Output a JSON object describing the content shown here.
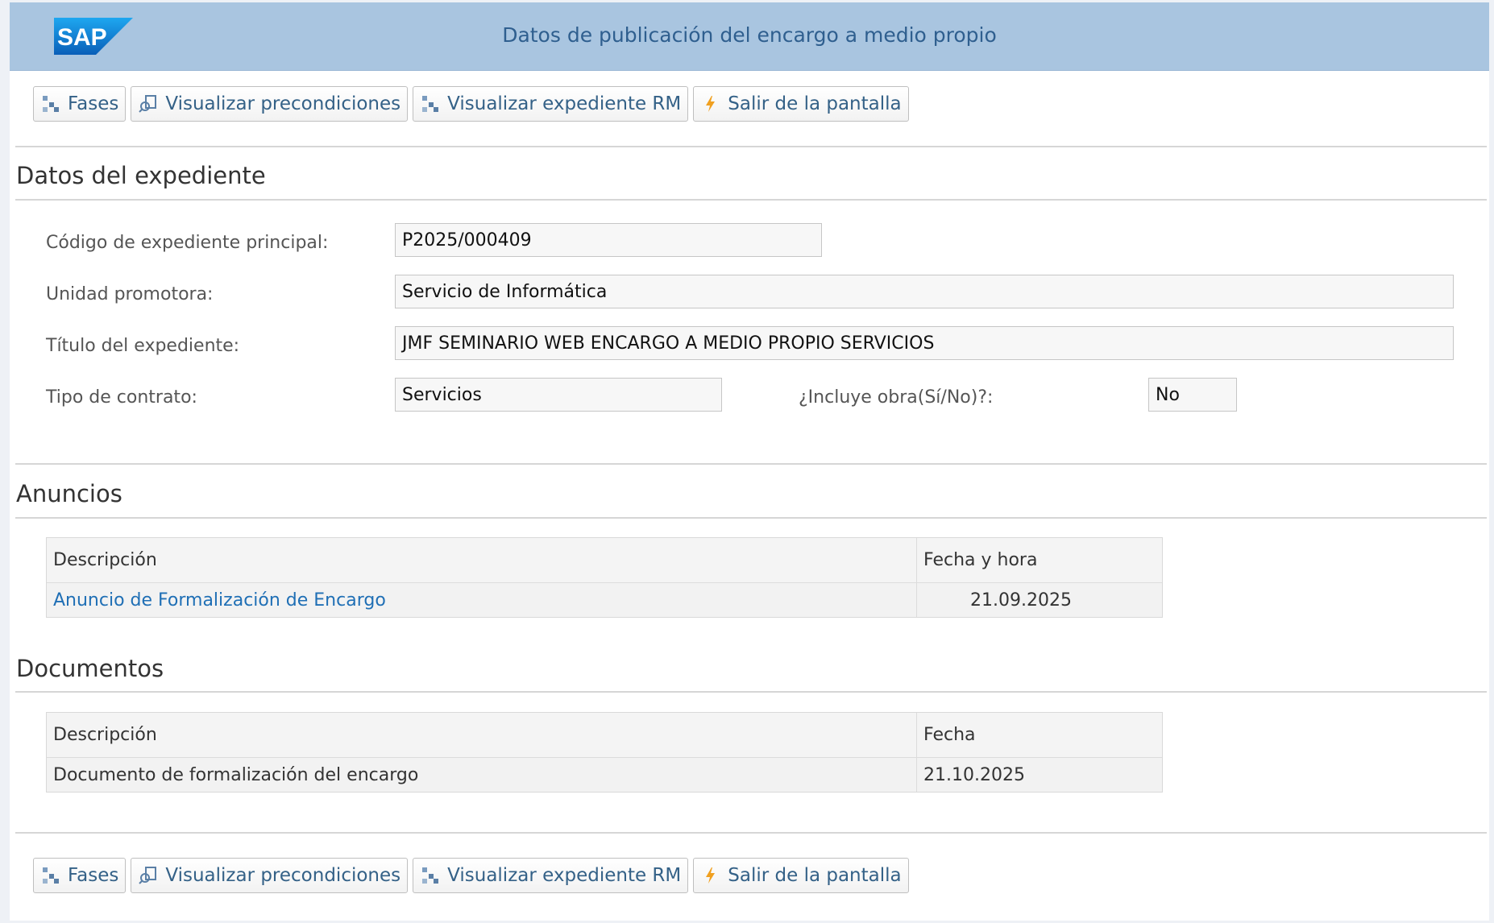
{
  "header": {
    "logo_text": "SAP",
    "title": "Datos de publicación del encargo a medio propio"
  },
  "toolbar": {
    "buttons": [
      {
        "label": "Fases",
        "icon": "phases-icon"
      },
      {
        "label": "Visualizar precondiciones",
        "icon": "preconditions-icon"
      },
      {
        "label": "Visualizar expediente RM",
        "icon": "hierarchy-icon"
      },
      {
        "label": "Salir de la pantalla",
        "icon": "lightning-icon"
      }
    ]
  },
  "expediente": {
    "section_title": "Datos del expediente",
    "codigo_label": "Código de expediente principal:",
    "codigo_value": "P2025/000409",
    "unidad_label": "Unidad promotora:",
    "unidad_value": "Servicio de Informática",
    "titulo_label": "Título del expediente:",
    "titulo_value": "JMF SEMINARIO WEB ENCARGO A MEDIO PROPIO SERVICIOS",
    "tipo_label": "Tipo de contrato:",
    "tipo_value": "Servicios",
    "obra_label": "¿Incluye obra(Sí/No)?:",
    "obra_value": "No"
  },
  "anuncios": {
    "section_title": "Anuncios",
    "columns": [
      "Descripción",
      "Fecha y hora"
    ],
    "rows": [
      {
        "descripcion": "Anuncio de Formalización de Encargo",
        "fecha": "21.09.2025"
      }
    ]
  },
  "documentos": {
    "section_title": "Documentos",
    "columns": [
      "Descripción",
      "Fecha"
    ],
    "rows": [
      {
        "descripcion": "Documento de formalización del encargo",
        "fecha": "21.10.2025"
      }
    ]
  },
  "colors": {
    "header_bg": "#a9c5e0",
    "header_text": "#2f5f8f",
    "link": "#1f6fb5",
    "sap_blue": "#0a6ed1"
  }
}
